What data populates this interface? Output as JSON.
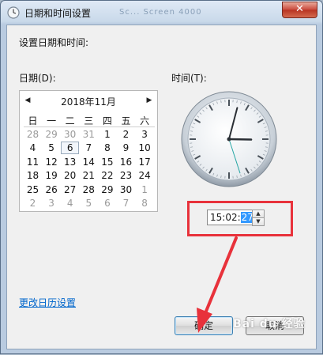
{
  "window": {
    "title": "日期和时间设置",
    "close_label": "✕",
    "ghost_title": "Sc... Screen 4000"
  },
  "main": {
    "heading": "设置日期和时间:",
    "date_label": "日期(D):",
    "time_label": "时间(T):",
    "change_calendar_link": "更改日历设置"
  },
  "calendar": {
    "title": "2018年11月",
    "prev": "◀",
    "next": "▶",
    "weekdays": [
      "日",
      "一",
      "二",
      "三",
      "四",
      "五",
      "六"
    ],
    "days": [
      [
        "28",
        "29",
        "30",
        "31",
        "1",
        "2",
        "3"
      ],
      [
        "4",
        "5",
        "6",
        "7",
        "8",
        "9",
        "10"
      ],
      [
        "11",
        "12",
        "13",
        "14",
        "15",
        "16",
        "17"
      ],
      [
        "18",
        "19",
        "20",
        "21",
        "22",
        "23",
        "24"
      ],
      [
        "25",
        "26",
        "27",
        "28",
        "29",
        "30",
        "1"
      ],
      [
        "2",
        "3",
        "4",
        "5",
        "6",
        "7",
        "8"
      ]
    ],
    "other_month_days": [
      [
        0,
        0
      ],
      [
        0,
        1
      ],
      [
        0,
        2
      ],
      [
        0,
        3
      ],
      [
        4,
        6
      ],
      [
        5,
        0
      ],
      [
        5,
        1
      ],
      [
        5,
        2
      ],
      [
        5,
        3
      ],
      [
        5,
        4
      ],
      [
        5,
        5
      ],
      [
        5,
        6
      ]
    ],
    "selected": [
      1,
      2
    ]
  },
  "time": {
    "prefix": "15:02:",
    "seconds": "27",
    "hour": 15,
    "minute": 2,
    "second": 27,
    "spin_up": "▲",
    "spin_down": "▼"
  },
  "buttons": {
    "ok": "确定",
    "cancel": "取消"
  },
  "watermark": "Bai du 经验",
  "colors": {
    "highlight": "#e8323b",
    "link": "#0066cc"
  }
}
